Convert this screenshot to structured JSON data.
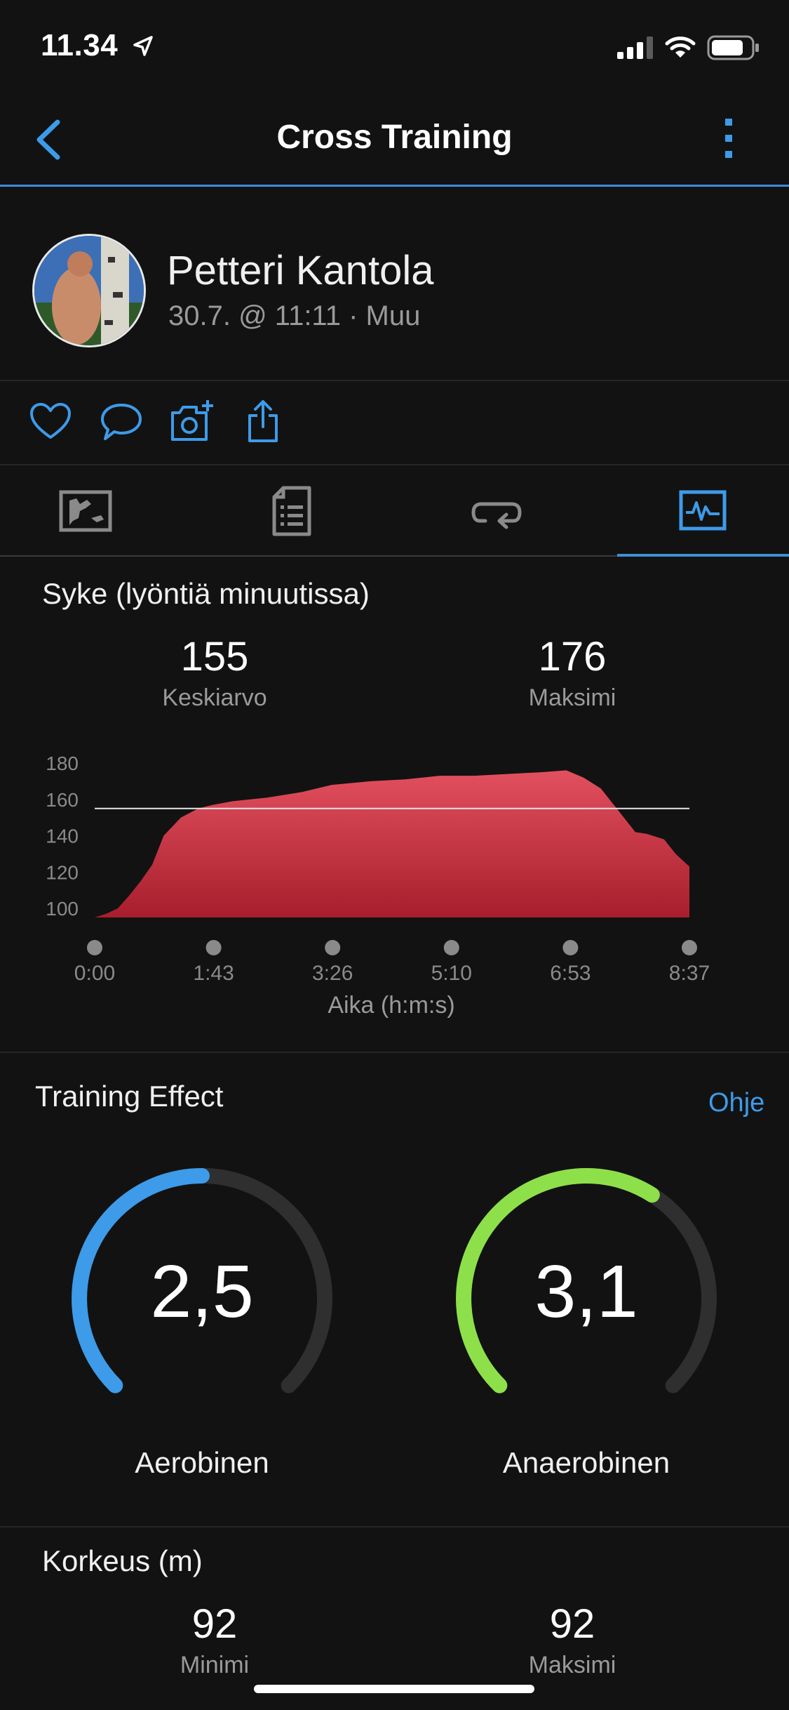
{
  "status": {
    "time": "11.34"
  },
  "nav": {
    "title": "Cross Training"
  },
  "profile": {
    "name": "Petteri Kantola",
    "meta": "30.7. @ 11:11 · Muu"
  },
  "heart_rate": {
    "title": "Syke (lyöntiä minuutissa)",
    "avg_value": "155",
    "avg_label": "Keskiarvo",
    "max_value": "176",
    "max_label": "Maksimi",
    "xlabel": "Aika (h:m:s)"
  },
  "chart_data": {
    "type": "area",
    "xlabel": "Aika (h:m:s)",
    "ylabel": "",
    "x_ticks": [
      "0:00",
      "1:43",
      "3:26",
      "5:10",
      "6:53",
      "8:37"
    ],
    "y_ticks": [
      "180",
      "160",
      "140",
      "120",
      "100"
    ],
    "ylim": [
      95,
      180
    ],
    "reference_line": 155,
    "series": [
      {
        "x": [
          0,
          10,
          20,
          30,
          40,
          50,
          60,
          75,
          90,
          103,
          120,
          150,
          180,
          206,
          240,
          270,
          300,
          330,
          360,
          390,
          410,
          425,
          440,
          450,
          460,
          470,
          480,
          495,
          505,
          517
        ],
        "values": [
          95,
          97,
          100,
          107,
          115,
          124,
          140,
          150,
          155,
          157,
          159,
          161,
          164,
          168,
          170,
          171,
          173,
          173,
          174,
          175,
          176,
          172,
          166,
          158,
          150,
          142,
          141,
          138,
          130,
          123
        ]
      }
    ],
    "color": "#d63a48"
  },
  "training_effect": {
    "title": "Training Effect",
    "help_label": "Ohje",
    "aerobic": {
      "value": "2,5",
      "label": "Aerobinen",
      "fraction": 0.5,
      "color": "#3d9be9"
    },
    "anaerobic": {
      "value": "3,1",
      "label": "Anaerobinen",
      "fraction": 0.62,
      "color": "#8ee04a"
    }
  },
  "elevation": {
    "title": "Korkeus (m)",
    "min_value": "92",
    "min_label": "Minimi",
    "max_value": "92",
    "max_label": "Maksimi"
  }
}
